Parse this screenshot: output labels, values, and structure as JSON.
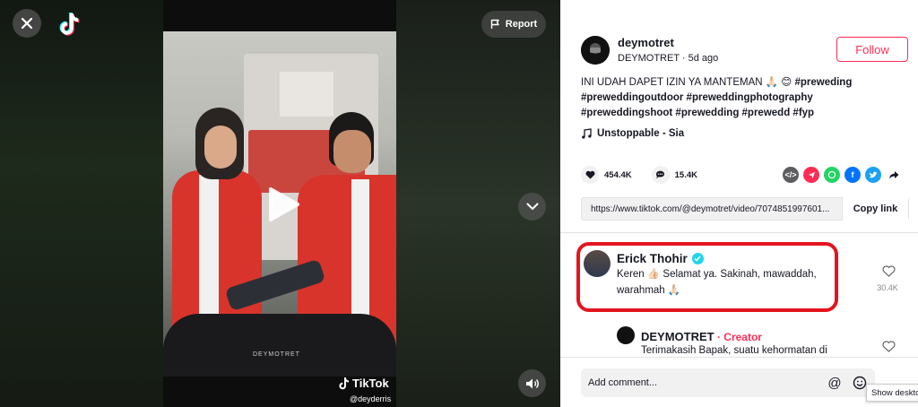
{
  "video": {
    "watermark_text": "DEYMOTRET",
    "tiktok_wordmark": "TikTok",
    "tiktok_username": "@deyderris",
    "report_label": "Report"
  },
  "author": {
    "name": "deymotret",
    "display_name": "DEYMOTRET",
    "separator": " · ",
    "posted": "5d ago",
    "follow_label": "Follow"
  },
  "caption": {
    "text": "INI UDAH DAPET IZIN YA MANTEMAN 🙏🏻 😊 ",
    "tags_line1": "#preweding",
    "tags_line2": "#preweddingoutdoor #preweddingphotography",
    "tags_line3": "#preweddingshoot #prewedding #prewedd #fyp"
  },
  "music": {
    "title": "Unstoppable - Sia"
  },
  "stats": {
    "likes": "454.4K",
    "comments": "15.4K"
  },
  "share": {
    "url": "https://www.tiktok.com/@deymotret/video/7074851997601...",
    "copy_label": "Copy link"
  },
  "comments": [
    {
      "author": "Erick Thohir",
      "text": "Keren 👍🏻 Selamat ya. Sakinah, mawaddah, warahmah 🙏🏻",
      "likes": "30.4K"
    },
    {
      "author": "DEYMOTRET",
      "badge_separator": " · ",
      "badge": "Creator",
      "text": "Terimakasih Bapak, suatu kehormatan di"
    }
  ],
  "comment_input": {
    "placeholder": "Add comment..."
  },
  "tooltip": "Show desktop",
  "colors": {
    "accent": "#fe2c55",
    "highlight": "#e4141f",
    "verified": "#20d5ec"
  }
}
